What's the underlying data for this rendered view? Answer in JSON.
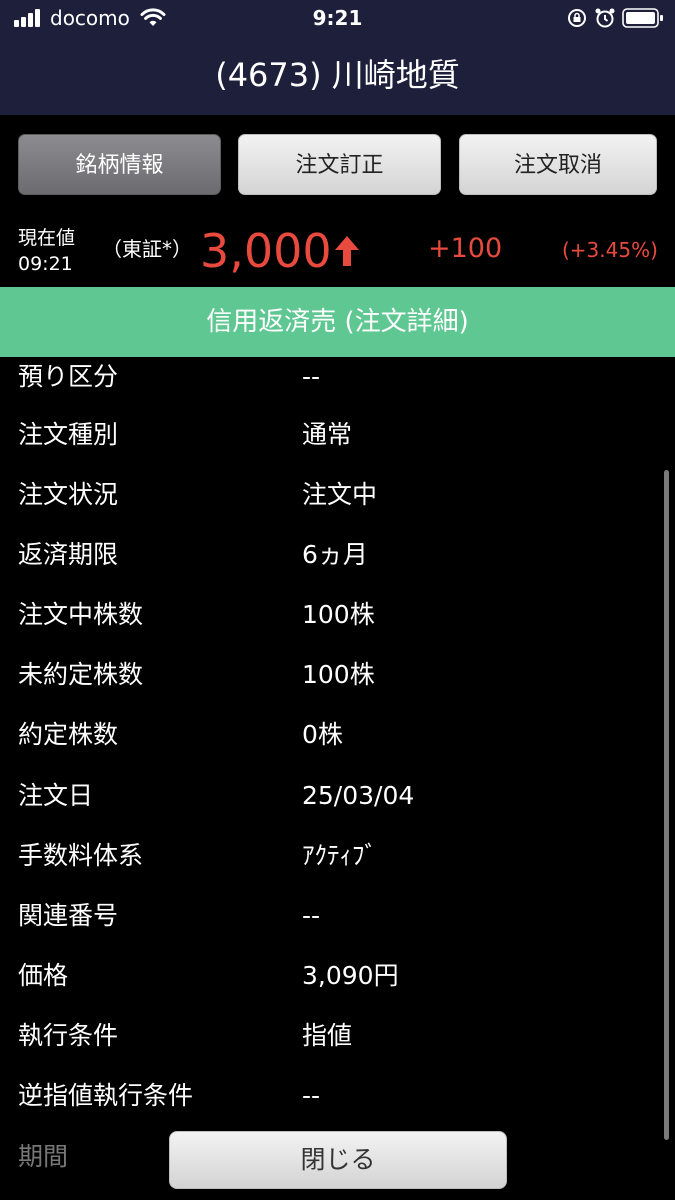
{
  "status_bar": {
    "carrier": "docomo",
    "time": "9:21",
    "icons": [
      "signal-icon",
      "wifi-icon",
      "rotation-lock-icon",
      "alarm-icon",
      "battery-icon"
    ]
  },
  "header": {
    "title": "(4673) 川崎地質"
  },
  "buttons": {
    "stock_info": "銘柄情報",
    "order_modify": "注文訂正",
    "order_cancel": "注文取消"
  },
  "quote": {
    "label": "現在値",
    "time": "09:21",
    "market": "（東証*）",
    "price": "3,000",
    "direction": "up",
    "change": "+100",
    "change_pct": "(+3.45%)",
    "up_color": "#e84a3d"
  },
  "section": {
    "title": "信用返済売 (注文詳細)",
    "color": "#5fc792"
  },
  "details": [
    {
      "key": "預り区分",
      "value": "--"
    },
    {
      "key": "注文種別",
      "value": "通常"
    },
    {
      "key": "注文状況",
      "value": "注文中"
    },
    {
      "key": "返済期限",
      "value": "6ヵ月"
    },
    {
      "key": "注文中株数",
      "value": "100株"
    },
    {
      "key": "未約定株数",
      "value": "100株"
    },
    {
      "key": "約定株数",
      "value": "0株"
    },
    {
      "key": "注文日",
      "value": "25/03/04"
    },
    {
      "key": "手数料体系",
      "value": "ｱｸﾃｨﾌﾞ"
    },
    {
      "key": "関連番号",
      "value": "--"
    },
    {
      "key": "価格",
      "value": "3,090円"
    },
    {
      "key": "執行条件",
      "value": "指値"
    },
    {
      "key": "逆指値執行条件",
      "value": "--"
    },
    {
      "key": "期間",
      "value": ""
    }
  ],
  "footer": {
    "close_label": "閉じる"
  }
}
